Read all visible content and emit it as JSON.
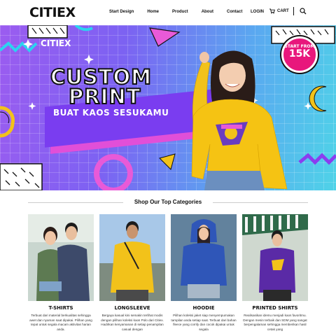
{
  "header": {
    "logo": "CITIEX",
    "nav": [
      "Start Design",
      "Home",
      "Product",
      "About",
      "Contact"
    ],
    "login": "LOGIN",
    "cart": "CART"
  },
  "banner": {
    "logo": "CITIEX",
    "line1": "CUSTOM",
    "line2": "PRINT",
    "subtitle": "BUAT KAOS SESUKAMU",
    "badge_top": "START FROM",
    "badge_price": "15K"
  },
  "section": {
    "title": "Shop Our Top Categories"
  },
  "categories": [
    {
      "name": "T-SHIRTS",
      "desc": "Terbuat dari material berkualitas sehingga awet dan nyaman saat dipakai. Pilihan yang tepat untuk segala macam aktivitas harian anda.",
      "colors": {
        "bg": "#c9d6cf",
        "shirt": "#5d7a52"
      }
    },
    {
      "name": "LONGSLEEVE",
      "desc": "Bergaya kasual kini semakin terlihat modis dengan pilihan koleksi kaos Polo dari Citiex. Hadirkan kenyamanan di setiap penampilan casual dengan",
      "colors": {
        "bg": "#a8c8e8",
        "shirt": "#f2c21a"
      }
    },
    {
      "name": "HOODIE",
      "desc": "Pilihan koleksi jaket siap menyempurnakan tampilan anda setiap saat. Terbuat dari bahan fleece yang comfy dan cocok dipakai untuk segala",
      "colors": {
        "bg": "#6f8fa8",
        "shirt": "#2f56b8"
      }
    },
    {
      "name": "PRINTED SHIRTS",
      "desc": "Realisasikan idemu menjadi kaos favoritmu. Dengan mesin terbaik dan SDM yang sangat berpengalaman sehingga memberikan hasil cetak yang",
      "colors": {
        "bg": "#cfd8cf",
        "shirt": "#5a2aa6"
      }
    }
  ]
}
